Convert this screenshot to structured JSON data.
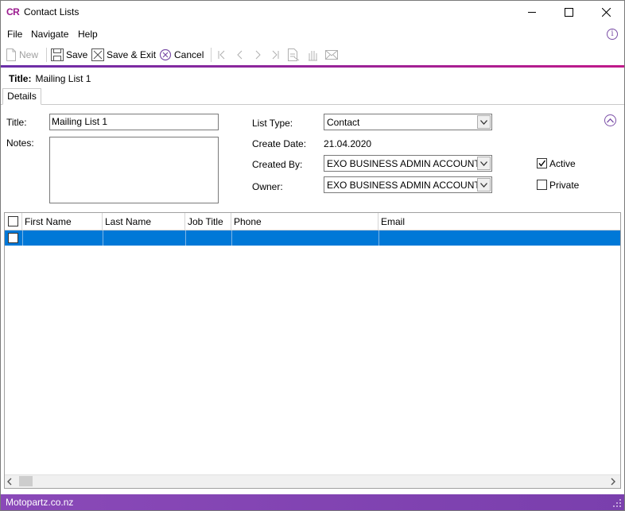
{
  "app": {
    "logo": "CR",
    "window_title": "Contact Lists"
  },
  "menu": {
    "file": "File",
    "navigate": "Navigate",
    "help": "Help"
  },
  "toolbar": {
    "new": "New",
    "save": "Save",
    "save_exit": "Save & Exit",
    "cancel": "Cancel"
  },
  "record": {
    "title_label": "Title:",
    "title_value": "Mailing List 1"
  },
  "tabs": {
    "details": "Details"
  },
  "form": {
    "title_label": "Title:",
    "title_value": "Mailing List 1",
    "notes_label": "Notes:",
    "notes_value": "",
    "list_type_label": "List Type:",
    "list_type_value": "Contact",
    "create_date_label": "Create Date:",
    "create_date_value": "21.04.2020",
    "created_by_label": "Created By:",
    "created_by_value": "EXO BUSINESS ADMIN ACCOUNT",
    "owner_label": "Owner:",
    "owner_value": "EXO BUSINESS ADMIN ACCOUNT",
    "active_label": "Active",
    "active_checked": true,
    "private_label": "Private",
    "private_checked": false
  },
  "grid": {
    "columns": [
      "First Name",
      "Last Name",
      "Job Title",
      "Phone",
      "Email"
    ],
    "rows": [
      [
        "",
        "",
        "",
        "",
        ""
      ]
    ]
  },
  "status": {
    "text": "Motopartz.co.nz"
  },
  "colors": {
    "accent": "#9b1b8f",
    "selection": "#0078d7",
    "status_bar": "#8a49b8"
  }
}
